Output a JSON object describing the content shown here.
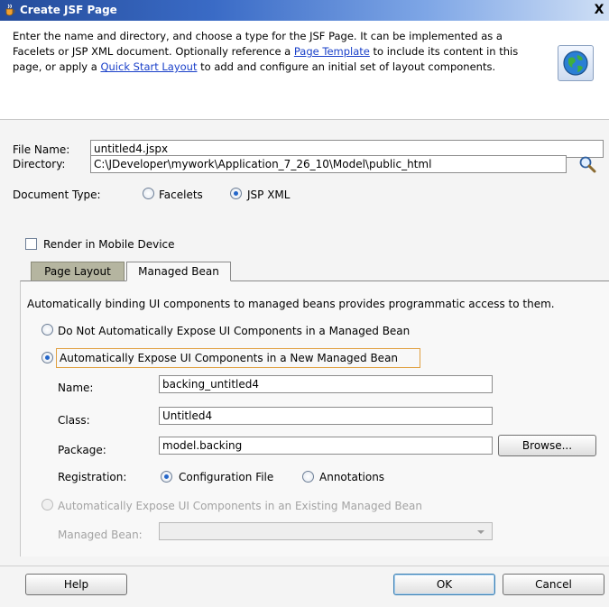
{
  "window": {
    "title": "Create JSF Page",
    "close_label": "X"
  },
  "header": {
    "desc_part1": "Enter the name and directory, and choose a type for the JSF Page. It can be implemented as a Facelets or JSP XML document. Optionally reference a ",
    "link_page_template": "Page Template",
    "desc_part2": " to include its content in this page, or apply a ",
    "link_quick_start": "Quick Start Layout",
    "desc_part3": " to add and configure an initial set of layout components."
  },
  "form": {
    "file_name_label": "File Name:",
    "file_name_value": "untitled4.jspx",
    "directory_label": "Directory:",
    "directory_value": "C:\\JDeveloper\\mywork\\Application_7_26_10\\Model\\public_html",
    "doc_type_label": "Document Type:",
    "facelets_label": "Facelets",
    "jsp_xml_label": "JSP XML",
    "mobile_label": "Render in Mobile Device"
  },
  "tabs": {
    "page_layout": "Page Layout",
    "managed_bean": "Managed Bean"
  },
  "managed_bean": {
    "intro": "Automatically binding UI components to managed beans provides programmatic access to them.",
    "opt_do_not": "Do Not Automatically Expose UI Components in a Managed Bean",
    "opt_new": "Automatically Expose UI Components in a New Managed Bean",
    "name_label": "Name:",
    "name_value": "backing_untitled4",
    "class_label": "Class:",
    "class_value": "Untitled4",
    "package_label": "Package:",
    "package_value": "model.backing",
    "browse_label": "Browse...",
    "registration_label": "Registration:",
    "config_file_label": "Configuration File",
    "annotations_label": "Annotations",
    "opt_existing": "Automatically Expose UI Components in an Existing Managed Bean",
    "managed_bean_label": "Managed Bean:",
    "managed_bean_value": ""
  },
  "buttons": {
    "help": "Help",
    "ok": "OK",
    "cancel": "Cancel"
  }
}
